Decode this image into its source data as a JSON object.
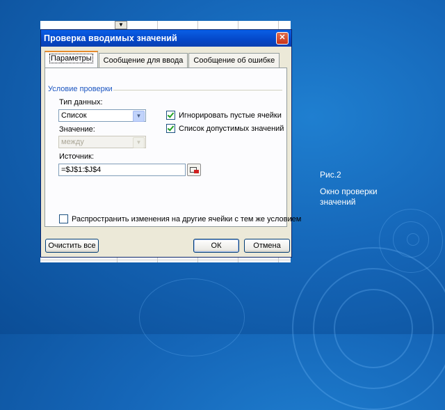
{
  "dialog": {
    "title": "Проверка вводимых значений",
    "close_glyph": "✕",
    "tabs": [
      {
        "label": "Параметры"
      },
      {
        "label": "Сообщение для ввода"
      },
      {
        "label": "Сообщение об ошибке"
      }
    ],
    "group_label": "Условие проверки",
    "data_type": {
      "label": "Тип данных:",
      "value": "Список"
    },
    "value_field": {
      "label": "Значение:",
      "value": "между"
    },
    "source": {
      "label": "Источник:",
      "value": "=$J$1:$J$4"
    },
    "ignore_blank": {
      "label": "Игнорировать пустые ячейки",
      "checked": true
    },
    "dropdown_list": {
      "label": "Список допустимых значений",
      "checked": true
    },
    "apply_all": {
      "label": "Распространить изменения на другие ячейки с тем же условием",
      "checked": false
    },
    "buttons": {
      "clear_all": "Очистить все",
      "ok": "ОК",
      "cancel": "Отмена"
    }
  },
  "caption": {
    "line1": "Рис.2",
    "line2": "Окно проверки значений"
  },
  "colors": {
    "background": "#1566b8",
    "titlebar": "#0447c8",
    "dialog_face": "#ece9d8",
    "group_label": "#1b55c0"
  },
  "icons": [
    "close-icon",
    "dropdown-arrow-icon",
    "range-picker-icon",
    "checkmark-icon"
  ]
}
